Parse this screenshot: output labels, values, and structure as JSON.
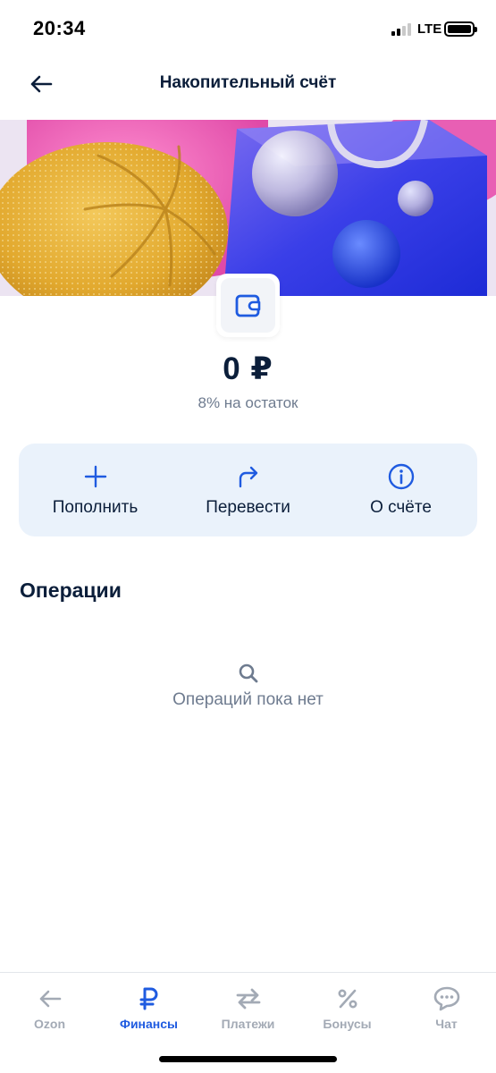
{
  "status_bar": {
    "time": "20:34",
    "network": "LTE"
  },
  "header": {
    "title": "Накопительный счёт",
    "back_icon": "arrow-left-icon"
  },
  "account": {
    "icon": "wallet-icon",
    "balance": "0 ₽",
    "rate": "8% на остаток"
  },
  "actions": [
    {
      "label": "Пополнить",
      "icon": "plus-icon"
    },
    {
      "label": "Перевести",
      "icon": "share-arrow-icon"
    },
    {
      "label": "О счёте",
      "icon": "info-icon"
    }
  ],
  "operations": {
    "title": "Операции",
    "empty_icon": "search-icon",
    "empty_text": "Операций пока нет"
  },
  "tabs": [
    {
      "label": "Ozon",
      "icon": "arrow-left-icon",
      "active": false
    },
    {
      "label": "Финансы",
      "icon": "ruble-icon",
      "active": true
    },
    {
      "label": "Платежи",
      "icon": "transfer-arrows-icon",
      "active": false
    },
    {
      "label": "Бонусы",
      "icon": "percent-icon",
      "active": false
    },
    {
      "label": "Чат",
      "icon": "chat-icon",
      "active": false
    }
  ],
  "colors": {
    "accent": "#1f5be0",
    "text": "#0b1e3a",
    "muted": "#6e7b8f",
    "card_bg": "#eaf2fb",
    "tab_inactive": "#a3aab5"
  }
}
